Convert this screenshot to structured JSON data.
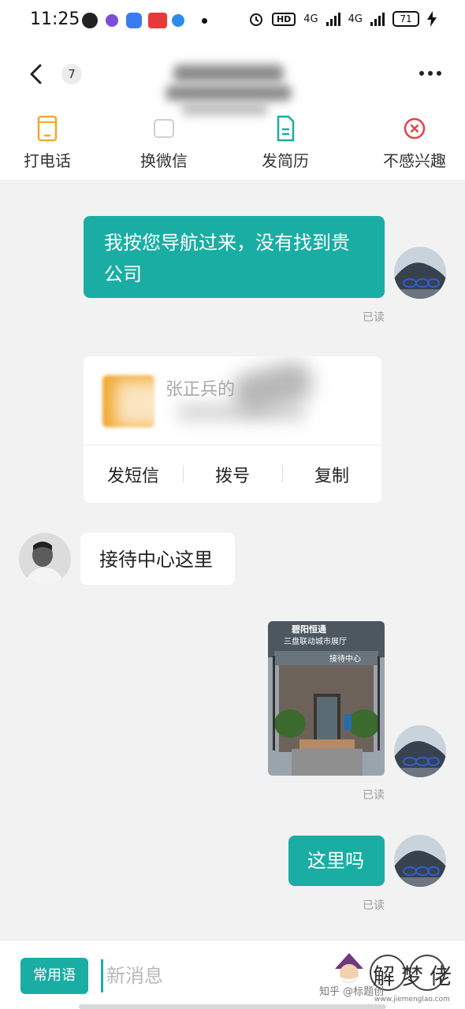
{
  "status_bar": {
    "time": "11:25",
    "hd": "HD",
    "net1": "4G",
    "net2": "4G",
    "battery": "71"
  },
  "header": {
    "unread_count": "7",
    "actions": [
      {
        "label": "打电话",
        "icon": "phone-icon"
      },
      {
        "label": "换微信",
        "icon": "wechat-swap-icon"
      },
      {
        "label": "发简历",
        "icon": "resume-icon"
      },
      {
        "label": "不感兴趣",
        "icon": "not-interested-icon"
      }
    ]
  },
  "messages": {
    "m1": {
      "text": "我按您导航过来，没有找到贵公司",
      "status": "已读"
    },
    "card": {
      "name": "张正兵的",
      "actions": [
        "发短信",
        "拨号",
        "复制"
      ]
    },
    "m2": {
      "text": "接待中心这里"
    },
    "photo": {
      "sign_line1": "碧阳恒通",
      "sign_line2": "三盘联动城市展厅",
      "sign_line3": "接待中心",
      "status": "已读"
    },
    "m3": {
      "text": "这里吗",
      "status": "已读"
    }
  },
  "input_bar": {
    "quick_phrases": "常用语",
    "placeholder": "新消息"
  },
  "watermark": {
    "brand": "解梦佬",
    "text": "知乎 @标题创",
    "url": "www.jiemenglao.com"
  },
  "colors": {
    "accent": "#1aada3",
    "background": "#f2f2f2",
    "danger": "#e0434a",
    "warning": "#f0a830"
  }
}
